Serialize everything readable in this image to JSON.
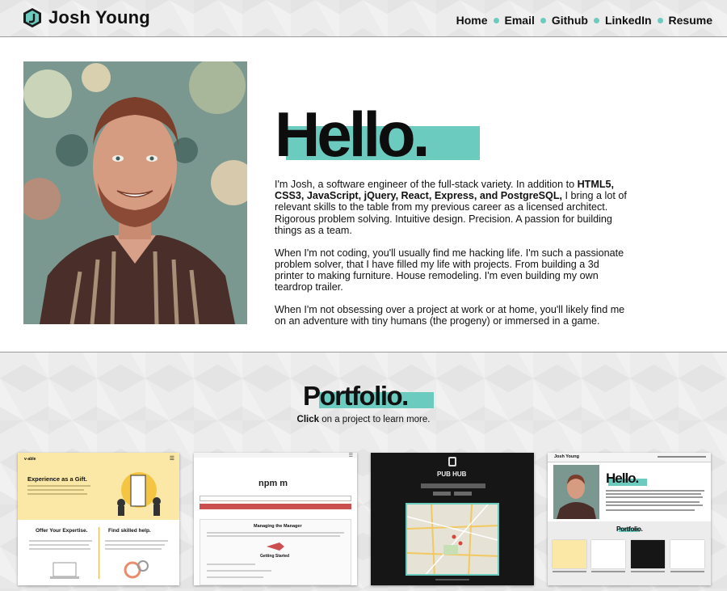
{
  "header": {
    "brand_name": "Josh Young",
    "nav": [
      {
        "label": "Home"
      },
      {
        "label": "Email"
      },
      {
        "label": "Github"
      },
      {
        "label": "LinkedIn"
      },
      {
        "label": "Resume"
      }
    ]
  },
  "about": {
    "title": "Hello.",
    "p1_intro": "I'm Josh, a software engineer of the full-stack variety. In addition to ",
    "p1_skills": "HTML5, CSS3, JavaScript, jQuery, React, Express, and PostgreSQL,",
    "p1_rest": " I bring a lot of relevant skills to the table from my previous career as a licensed architect. Rigorous problem solving. Intuitive design. Precision. A passion for building things as a team.",
    "p2": "When I'm not coding, you'll usually find me hacking life. I'm such a passionate problem solver, that I have filled my life with projects. From building a 3d printer to making furniture. House remodeling. I'm even building my own teardrop trailer.",
    "p3": "When I'm not obsessing over a project at work or at home, you'll likely find me on an adventure with tiny humans (the progeny) or immersed in a game."
  },
  "portfolio": {
    "title": "Portfolio.",
    "subtitle_bold": "Click",
    "subtitle_rest": " on a project to learn more.",
    "projects": [
      {
        "logo": "v-able",
        "headline": "Experience as a Gift.",
        "col1": "Offer Your Expertise.",
        "col2": "Find skilled help."
      },
      {
        "logo": "npm m",
        "panel_title": "Managing the Manager",
        "panel_sub": "Getting Started"
      },
      {
        "title": "PUB HUB"
      },
      {
        "brand": "Josh Young",
        "hello": "Hello.",
        "portfolio": "Portfolio."
      }
    ]
  },
  "colors": {
    "accent": "#6ccbbf",
    "text": "#111111",
    "background": "#ececec"
  }
}
